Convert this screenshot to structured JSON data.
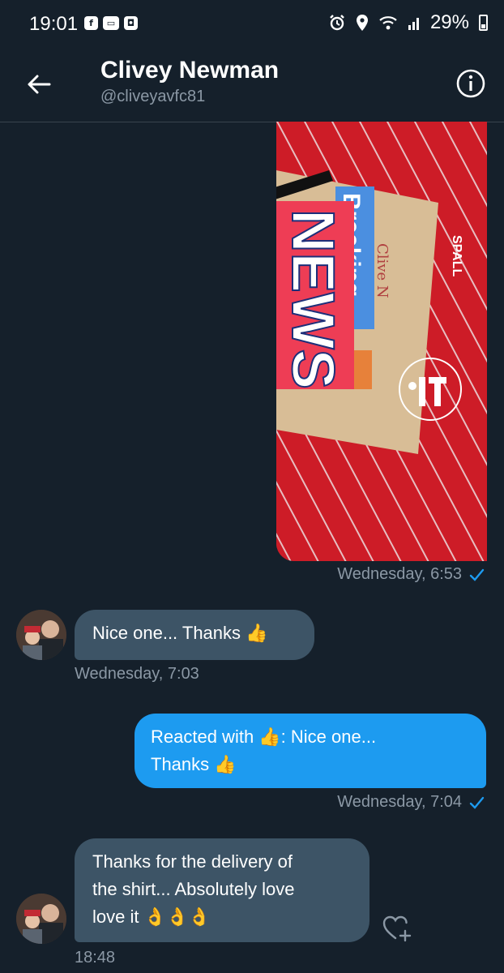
{
  "status_bar": {
    "time": "19:01",
    "battery": "29%",
    "icons": [
      "app-icon-f",
      "app-icon-cloud",
      "app-icon-square",
      "alarm-icon",
      "location-icon",
      "wifi-icon",
      "signal-icon",
      "battery-icon"
    ]
  },
  "header": {
    "name": "Clivey Newman",
    "handle": "@cliveyavfc81"
  },
  "messages": {
    "image_time": "Wednesday, 6:53",
    "msg1_text": "Nice one... Thanks 👍",
    "msg1_time": "Wednesday, 7:03",
    "msg2_line1": "Reacted with 👍: Nice one...",
    "msg2_line2": "Thanks 👍",
    "msg2_time": "Wednesday, 7:04",
    "msg3_line1": "Thanks for the delivery of",
    "msg3_line2": "the shirt... Absolutely love",
    "msg3_line3": "love it 👌👌👌",
    "msg3_time": "18:48"
  },
  "image_text": {
    "breaking": "Breaking",
    "news": "NEWS",
    "envelope": "Clive N",
    "shirt_sponsor": "SPALL"
  },
  "colors": {
    "background": "#15202b",
    "incoming_bubble": "#3d5466",
    "outgoing_bubble": "#1d9bf0",
    "meta_text": "#8b98a5",
    "shirt_red": "#d81e2a"
  }
}
